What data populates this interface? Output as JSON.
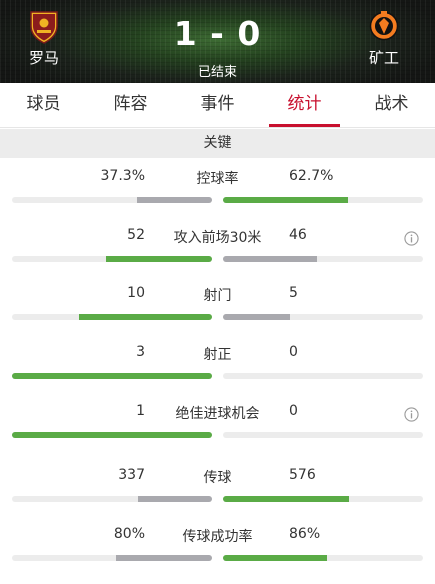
{
  "match": {
    "home_team": "罗马",
    "away_team": "矿工",
    "score": "1 - 0",
    "status": "已结束"
  },
  "tabs": [
    {
      "label": "球员",
      "active": false
    },
    {
      "label": "阵容",
      "active": false
    },
    {
      "label": "事件",
      "active": false
    },
    {
      "label": "统计",
      "active": true
    },
    {
      "label": "战术",
      "active": false
    }
  ],
  "section": {
    "title": "关键"
  },
  "colors": {
    "accent": "#c8102e",
    "winner_bar": "#5aab46",
    "loser_bar": "#a9a9ae",
    "track": "#ececec"
  },
  "stats": [
    {
      "label": "控球率",
      "left": "37.3%",
      "right": "62.7%",
      "left_fraction": 0.373,
      "right_fraction": 0.627,
      "left_leads": false,
      "right_leads": true,
      "info": false
    },
    {
      "label": "攻入前场30米",
      "left": "52",
      "right": "46",
      "left_fraction": 0.53,
      "right_fraction": 0.47,
      "left_leads": true,
      "right_leads": false,
      "info": true
    },
    {
      "label": "射门",
      "left": "10",
      "right": "5",
      "left_fraction": 0.667,
      "right_fraction": 0.333,
      "left_leads": true,
      "right_leads": false,
      "info": false
    },
    {
      "label": "射正",
      "left": "3",
      "right": "0",
      "left_fraction": 1.0,
      "right_fraction": 0.0,
      "left_leads": true,
      "right_leads": false,
      "info": false
    },
    {
      "label": "绝佳进球机会",
      "left": "1",
      "right": "0",
      "left_fraction": 1.0,
      "right_fraction": 0.0,
      "left_leads": true,
      "right_leads": false,
      "info": true
    },
    {
      "label": "传球",
      "left": "337",
      "right": "576",
      "left_fraction": 0.369,
      "right_fraction": 0.631,
      "left_leads": false,
      "right_leads": true,
      "info": false
    },
    {
      "label": "传球成功率",
      "left": "80%",
      "right": "86%",
      "left_fraction": 0.48,
      "right_fraction": 0.52,
      "left_leads": false,
      "right_leads": true,
      "info": false
    }
  ]
}
